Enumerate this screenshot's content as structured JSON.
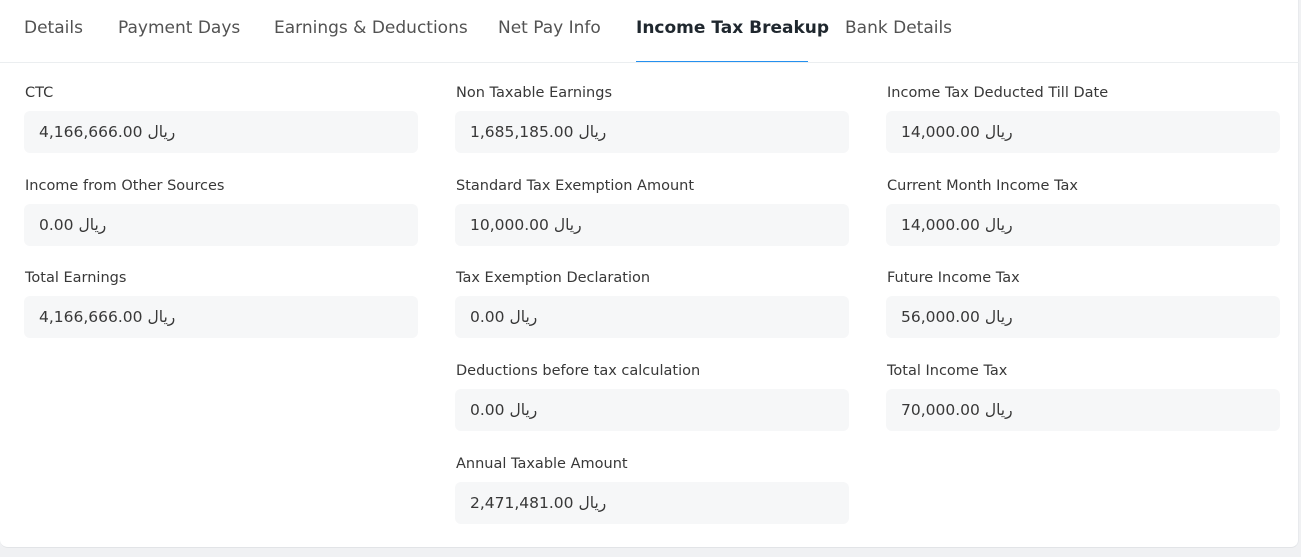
{
  "tabs": [
    {
      "label": "Details",
      "active": false
    },
    {
      "label": "Payment Days",
      "active": false
    },
    {
      "label": "Earnings & Deductions",
      "active": false
    },
    {
      "label": "Net Pay Info",
      "active": false
    },
    {
      "label": "Income Tax Breakup",
      "active": true
    },
    {
      "label": "Bank Details",
      "active": false
    }
  ],
  "accent_color": "#2490ef",
  "columns": {
    "left": [
      {
        "label": "CTC",
        "value": "4,166,666.00 ريال"
      },
      {
        "label": "Income from Other Sources",
        "value": "0.00 ريال"
      },
      {
        "label": "Total Earnings",
        "value": "4,166,666.00 ريال"
      }
    ],
    "middle": [
      {
        "label": "Non Taxable Earnings",
        "value": "1,685,185.00 ريال"
      },
      {
        "label": "Standard Tax Exemption Amount",
        "value": "10,000.00 ريال"
      },
      {
        "label": "Tax Exemption Declaration",
        "value": "0.00 ريال"
      },
      {
        "label": "Deductions before tax calculation",
        "value": "0.00 ريال"
      },
      {
        "label": "Annual Taxable Amount",
        "value": "2,471,481.00 ريال"
      }
    ],
    "right": [
      {
        "label": "Income Tax Deducted Till Date",
        "value": "14,000.00 ريال"
      },
      {
        "label": "Current Month Income Tax",
        "value": "14,000.00 ريال"
      },
      {
        "label": "Future Income Tax",
        "value": "56,000.00 ريال"
      },
      {
        "label": "Total Income Tax",
        "value": "70,000.00 ريال"
      }
    ]
  }
}
